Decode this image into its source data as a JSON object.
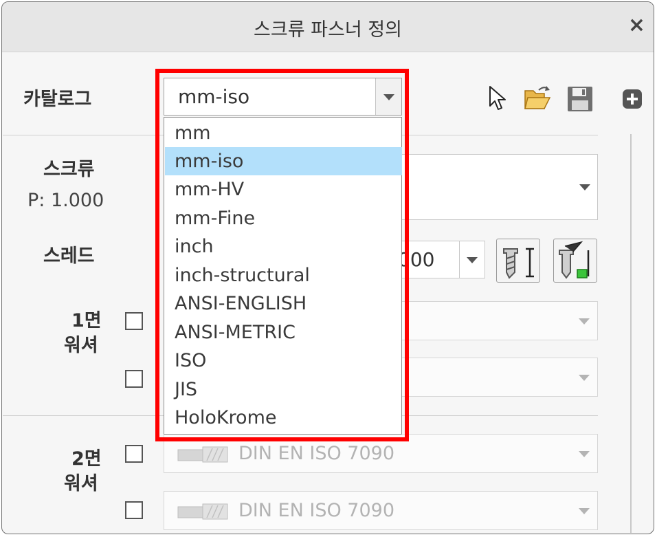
{
  "window": {
    "title": "스크류 파스너 정의",
    "close_glyph": "×"
  },
  "catalog": {
    "label": "카탈로그",
    "selected": "mm-iso",
    "options": [
      "mm",
      "mm-iso",
      "mm-HV",
      "mm-Fine",
      "inch",
      "inch-structural",
      "ANSI-ENGLISH",
      "ANSI-METRIC",
      "ISO",
      "JIS",
      "HoloKrome"
    ],
    "selected_index": 1
  },
  "toolbar": {
    "icons": [
      "cursor-icon",
      "folder-open-icon",
      "save-icon",
      "add-icon"
    ]
  },
  "screw": {
    "label": "스크류",
    "pitch": "P: 1.000"
  },
  "thread": {
    "label": "스레드",
    "value_partial": "000"
  },
  "washer1": {
    "label_line1": "1면",
    "label_line2": "워셔"
  },
  "washer2": {
    "label_line1": "2면",
    "label_line2": "워셔",
    "value_a": "DIN EN ISO 7090",
    "value_b": "DIN EN ISO 7090"
  },
  "colors": {
    "highlight": "#ff0000",
    "selection": "#b3e0fb"
  }
}
